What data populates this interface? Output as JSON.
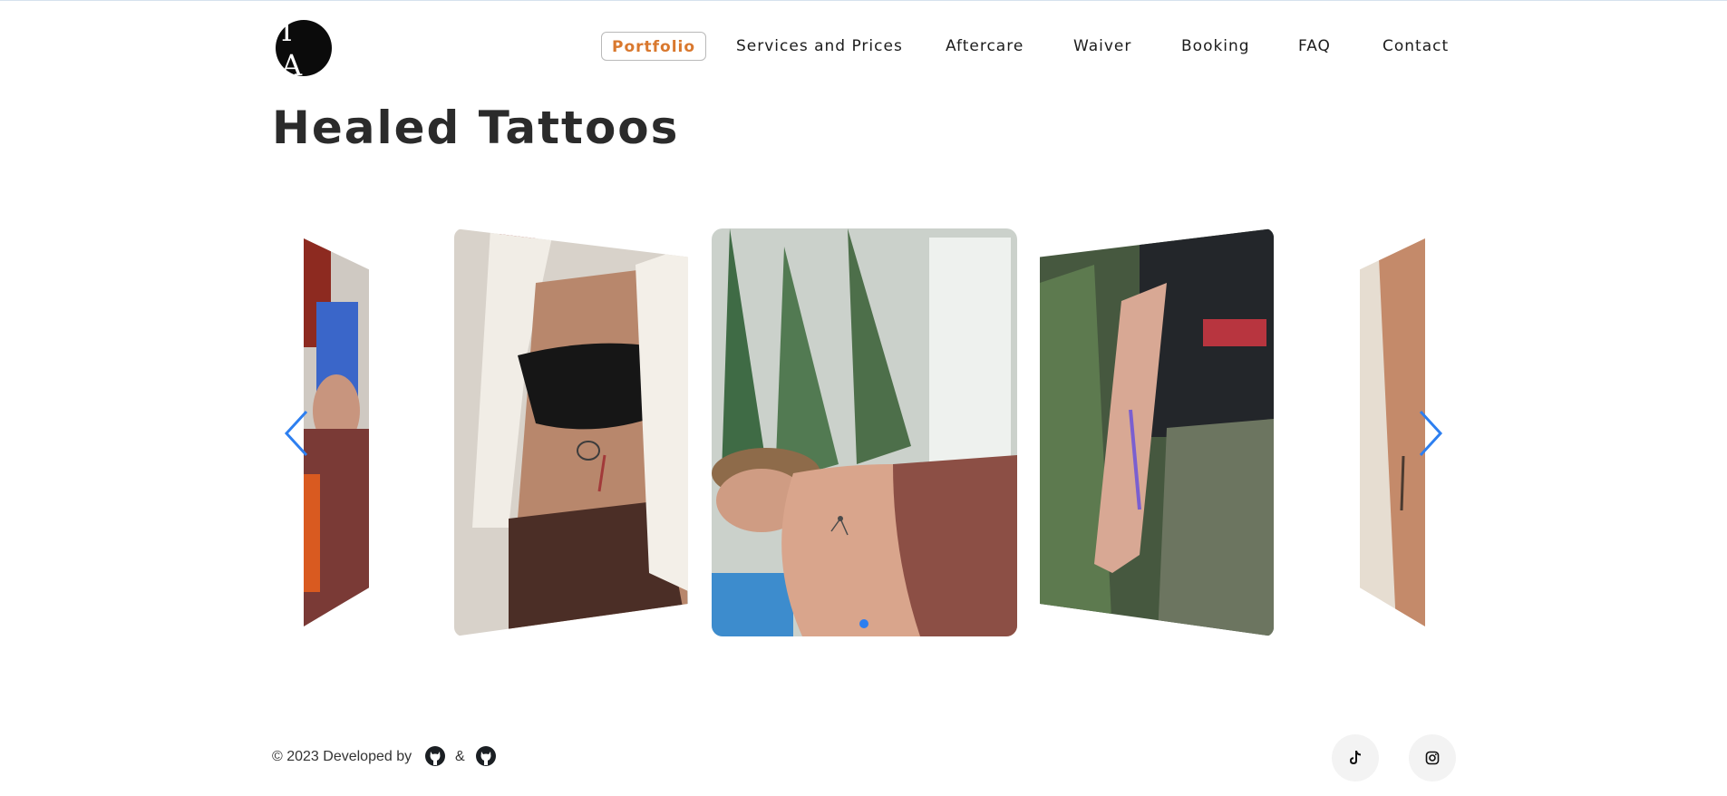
{
  "header": {
    "logo_text": "I A",
    "nav": [
      {
        "label": "Portfolio",
        "active": true
      },
      {
        "label": "Services and Prices",
        "active": false
      },
      {
        "label": "Aftercare",
        "active": false
      },
      {
        "label": "Waiver",
        "active": false
      },
      {
        "label": "Booking",
        "active": false
      },
      {
        "label": "FAQ",
        "active": false
      },
      {
        "label": "Contact",
        "active": false
      }
    ]
  },
  "main": {
    "title": "Healed Tattoos",
    "carousel": {
      "slides": [
        {
          "name": "slide-far-left",
          "icon": "photo"
        },
        {
          "name": "slide-left",
          "icon": "photo"
        },
        {
          "name": "slide-center",
          "icon": "photo"
        },
        {
          "name": "slide-right",
          "icon": "photo"
        },
        {
          "name": "slide-far-right",
          "icon": "photo"
        }
      ],
      "prev_icon": "chevron-left-icon",
      "next_icon": "chevron-right-icon",
      "accent_color": "#2d7ff0",
      "active_slide": 3
    }
  },
  "footer": {
    "credit": "© 2023 Developed by",
    "ampersand": "&",
    "github_icons": [
      "github-icon",
      "github-icon"
    ],
    "social": [
      {
        "name": "tiktok",
        "icon": "tiktok-icon"
      },
      {
        "name": "instagram",
        "icon": "instagram-icon"
      }
    ]
  },
  "colors": {
    "active_nav": "#d9782e",
    "text": "#222222",
    "arrow": "#2d7ff0"
  }
}
